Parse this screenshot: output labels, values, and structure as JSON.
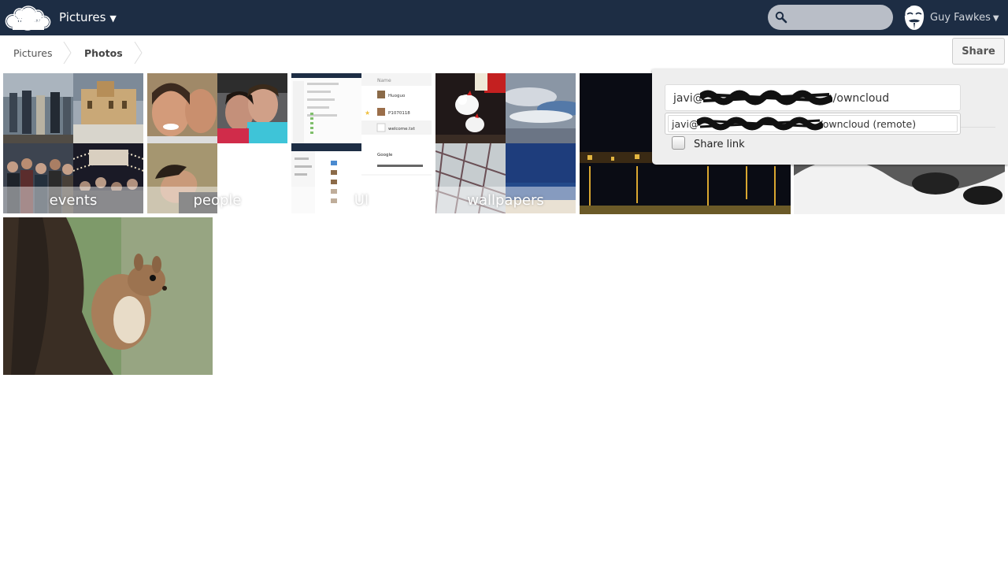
{
  "header": {
    "app_name": "Pictures",
    "caret": "▼",
    "search_placeholder": "",
    "user_name": "Guy Fawkes",
    "user_caret": "▼",
    "bg_color": "#1d2d44"
  },
  "breadcrumb": {
    "items": [
      "Pictures",
      "Photos"
    ]
  },
  "toolbar": {
    "share_label": "Share"
  },
  "albums": [
    {
      "label": "events"
    },
    {
      "label": "people"
    },
    {
      "label": "UI"
    },
    {
      "label": "wallpapers"
    }
  ],
  "ui_thumb": {
    "column_header": "Name",
    "files": [
      "Huoguo",
      "P1070118",
      "welcome.txt"
    ],
    "google": "Google"
  },
  "photos": [
    {
      "icon": "night-river-city-photo"
    },
    {
      "icon": "ocean-waves-rocks-photo"
    },
    {
      "icon": "squirrel-on-tree-photo"
    }
  ],
  "share_dropdown": {
    "input_prefix": "javi@",
    "input_suffix": "/owncloud",
    "suggestion_prefix": "javi@",
    "suggestion_suffix": "/owncloud (remote)",
    "share_link_label": "Share link"
  }
}
